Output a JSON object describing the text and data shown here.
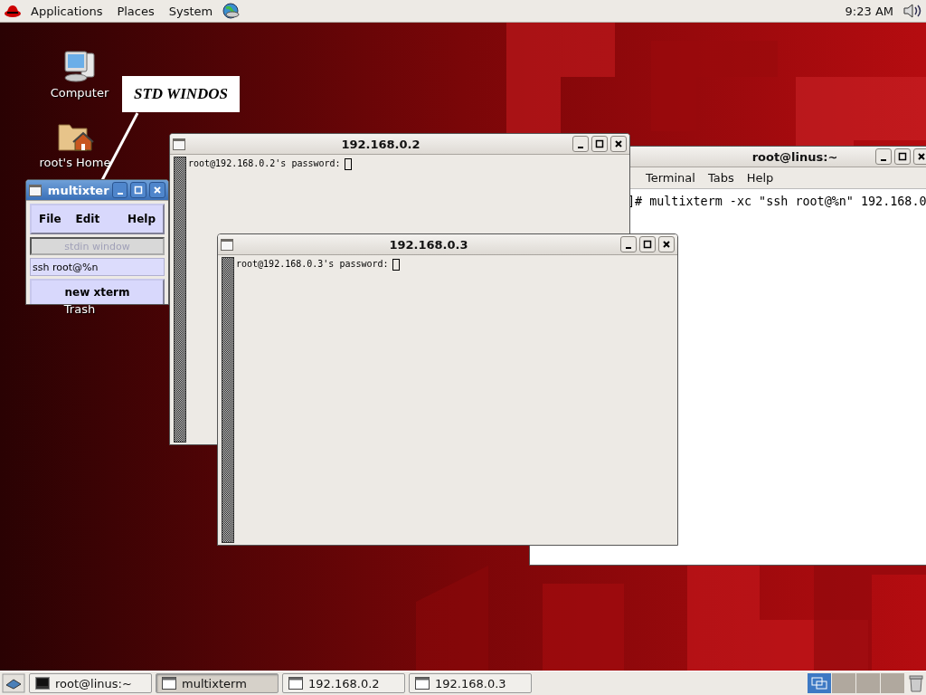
{
  "top_panel": {
    "menus": [
      {
        "label": "Applications"
      },
      {
        "label": "Places"
      },
      {
        "label": "System"
      }
    ],
    "clock": "9:23 AM"
  },
  "desktop_icons": [
    {
      "label": "Computer",
      "kind": "computer"
    },
    {
      "label": "root's Home",
      "kind": "home"
    },
    {
      "label": "Trash",
      "kind": "trash"
    }
  ],
  "callout": {
    "text": "STD WINDOS"
  },
  "windows": [
    {
      "kind": "terminal",
      "title": "root@linus:~",
      "focused": false,
      "menus": [
        "Terminal",
        "Tabs",
        "Help"
      ],
      "lines": [
        "]# multixterm -xc \"ssh root@%n\" 192.168.0"
      ]
    },
    {
      "kind": "xterm",
      "title": "192.168.0.2",
      "focused": false,
      "lines": [
        "root@192.168.0.2's password:"
      ]
    },
    {
      "kind": "xterm",
      "title": "192.168.0.3",
      "focused": false,
      "lines": [
        "root@192.168.0.3's password:"
      ]
    },
    {
      "kind": "multixterm",
      "title": "multixter",
      "focused": true,
      "menus": [
        "File",
        "Edit",
        "Help"
      ],
      "stdin": {
        "label": "stdin window",
        "disabled": true
      },
      "command": {
        "value": "ssh root@%n"
      },
      "button": "new xterm"
    }
  ],
  "taskbar": {
    "items": [
      {
        "label": "root@linus:~",
        "kind": "terminal",
        "selected": false
      },
      {
        "label": "multixterm",
        "kind": "window",
        "selected": true
      },
      {
        "label": "192.168.0.2",
        "kind": "window",
        "selected": false
      },
      {
        "label": "192.168.0.3",
        "kind": "window",
        "selected": false
      }
    ],
    "workspaces": [
      {
        "selected": true
      },
      {
        "selected": false
      },
      {
        "selected": false
      },
      {
        "selected": false
      }
    ]
  }
}
